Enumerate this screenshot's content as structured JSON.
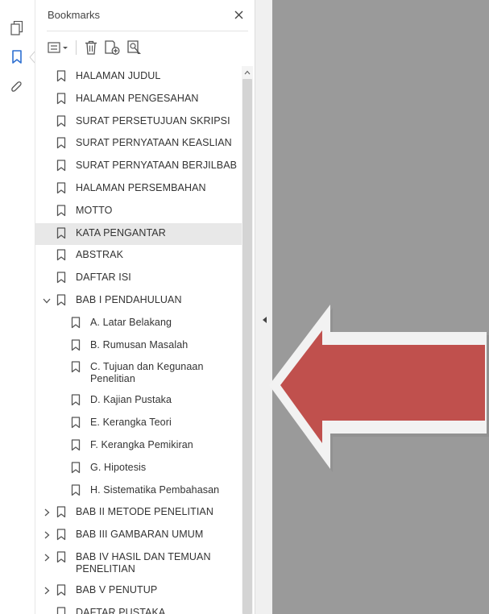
{
  "rail": {
    "icons": [
      "pages-icon",
      "bookmark-icon",
      "paperclip-icon"
    ],
    "active": "bookmark-icon"
  },
  "panel": {
    "title": "Bookmarks",
    "toolbar": [
      "options-menu-icon",
      "delete-bookmark-icon",
      "new-bookmark-icon",
      "bookmark-search-icon"
    ]
  },
  "bookmarks": [
    {
      "label": "HALAMAN JUDUL",
      "level": 0
    },
    {
      "label": "HALAMAN PENGESAHAN",
      "level": 0
    },
    {
      "label": "SURAT PERSETUJUAN SKRIPSI",
      "level": 0
    },
    {
      "label": "SURAT PERNYATAAN KEASLIAN",
      "level": 0
    },
    {
      "label": "SURAT PERNYATAAN BERJILBAB",
      "level": 0
    },
    {
      "label": "HALAMAN PERSEMBAHAN",
      "level": 0
    },
    {
      "label": "MOTTO",
      "level": 0
    },
    {
      "label": "KATA PENGANTAR",
      "level": 0,
      "selected": true
    },
    {
      "label": "ABSTRAK",
      "level": 0
    },
    {
      "label": "DAFTAR ISI",
      "level": 0
    },
    {
      "label": "BAB I PENDAHULUAN",
      "level": 0,
      "expander": "expanded"
    },
    {
      "label": "A. Latar Belakang",
      "level": 1
    },
    {
      "label": "B. Rumusan Masalah",
      "level": 1
    },
    {
      "label": "C. Tujuan dan Kegunaan Penelitian",
      "level": 1
    },
    {
      "label": "D. Kajian Pustaka",
      "level": 1
    },
    {
      "label": "E. Kerangka Teori",
      "level": 1
    },
    {
      "label": "F. Kerangka Pemikiran",
      "level": 1
    },
    {
      "label": "G. Hipotesis",
      "level": 1
    },
    {
      "label": "H. Sistematika Pembahasan",
      "level": 1
    },
    {
      "label": "BAB II METODE PENELITIAN",
      "level": 0,
      "expander": "collapsed"
    },
    {
      "label": "BAB III GAMBARAN UMUM",
      "level": 0,
      "expander": "collapsed"
    },
    {
      "label": "BAB IV HASIL DAN TEMUAN PENELITIAN",
      "level": 0,
      "expander": "collapsed"
    },
    {
      "label": "BAB V PENUTUP",
      "level": 0,
      "expander": "collapsed"
    },
    {
      "label": "DAFTAR PUSTAKA",
      "level": 0
    }
  ],
  "colors": {
    "accent": "#2d6fd1",
    "icon": "#555555",
    "selected_row": "#e8e8e8",
    "document_bg": "#9a9a9a",
    "arrow_fill": "#c0504d",
    "arrow_outline": "#ffffff"
  }
}
